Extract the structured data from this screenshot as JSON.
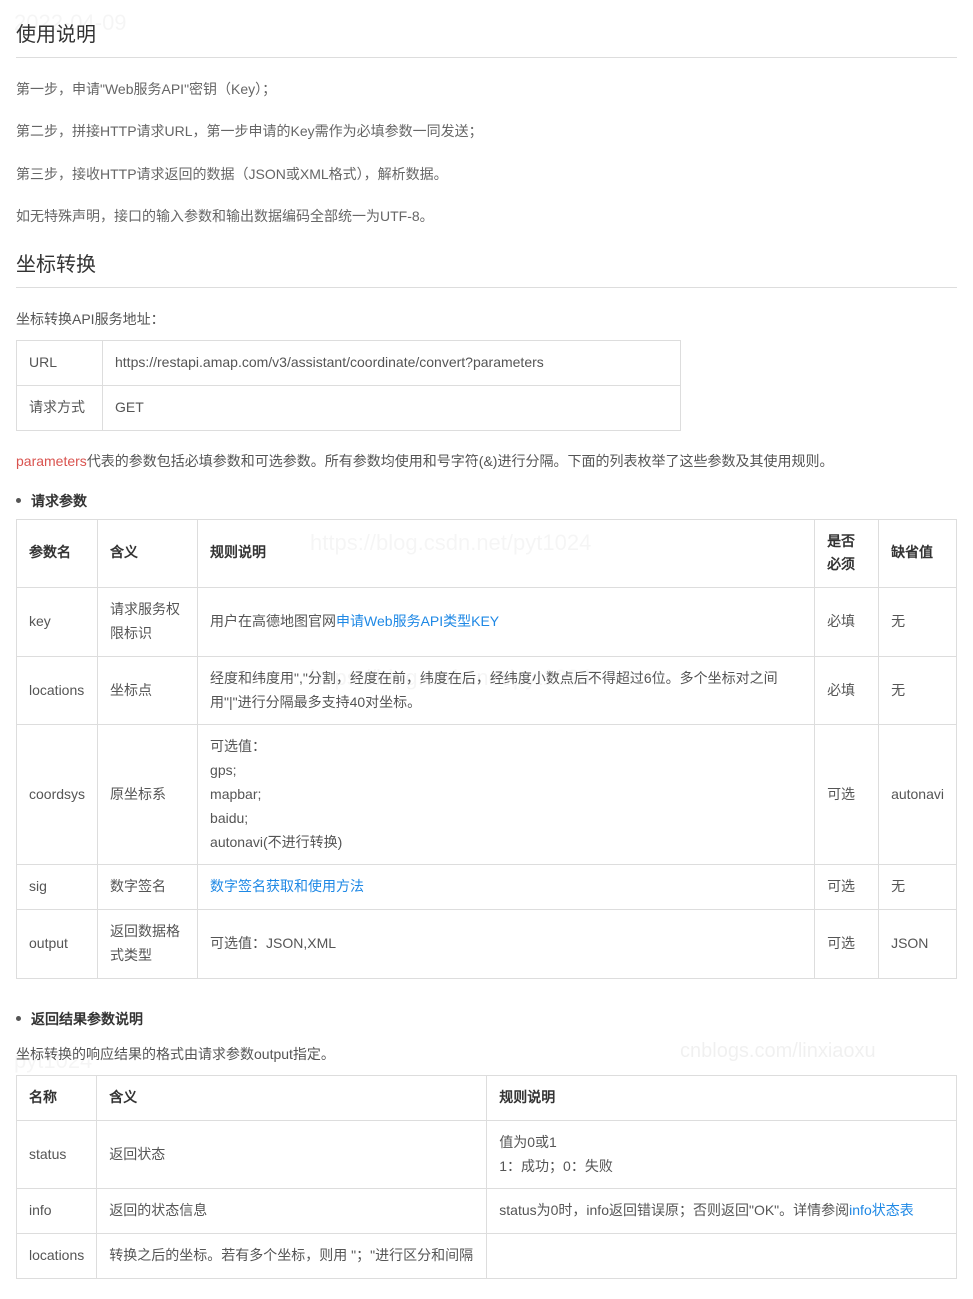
{
  "watermarks": {
    "w1": "2022-04-09",
    "w2": "https://blog.csdn.net/pyt1024",
    "w3": "https://blog.csdn.net/pyt1024",
    "w4": "cnblogs.com/linxiaoxu",
    "w5": "pyt1024"
  },
  "section1": {
    "title": "使用说明",
    "p1": "第一步，申请\"Web服务API\"密钥（Key）；",
    "p2": "第二步，拼接HTTP请求URL，第一步申请的Key需作为必填参数一同发送；",
    "p3": "第三步，接收HTTP请求返回的数据（JSON或XML格式），解析数据。",
    "p4": "如无特殊声明，接口的输入参数和输出数据编码全部统一为UTF-8。"
  },
  "section2": {
    "title": "坐标转换",
    "intro": "坐标转换API服务地址：",
    "url_table": {
      "rows": [
        {
          "label": "URL",
          "value": "https://restapi.amap.com/v3/assistant/coordinate/convert?parameters"
        },
        {
          "label": "请求方式",
          "value": "GET"
        }
      ]
    },
    "params_note_red": "parameters",
    "params_note_rest": "代表的参数包括必填参数和可选参数。所有参数均使用和号字符(&)进行分隔。下面的列表枚举了这些参数及其使用规则。",
    "request_bullet": "请求参数",
    "request_table": {
      "headers": [
        "参数名",
        "含义",
        "规则说明",
        "是否必须",
        "缺省值"
      ],
      "rows": [
        {
          "c0": "key",
          "c1": "请求服务权限标识",
          "c2_pre": "用户在高德地图官网",
          "c2_link": "申请Web服务API类型KEY",
          "c2_post": "",
          "c3": "必填",
          "c4": "无"
        },
        {
          "c0": "locations",
          "c1": "坐标点",
          "c2": "经度和纬度用\",\"分割，经度在前，纬度在后，经纬度小数点后不得超过6位。多个坐标对之间用\"|\"进行分隔最多支持40对坐标。",
          "c3": "必填",
          "c4": "无"
        },
        {
          "c0": "coordsys",
          "c1": "原坐标系",
          "c2_lines": [
            "可选值：",
            "gps;",
            "mapbar;",
            "baidu;",
            "autonavi(不进行转换)"
          ],
          "c3": "可选",
          "c4": "autonavi"
        },
        {
          "c0": "sig",
          "c1": "数字签名",
          "c2_linkonly": "数字签名获取和使用方法",
          "c3": "可选",
          "c4": "无"
        },
        {
          "c0": "output",
          "c1": "返回数据格式类型",
          "c2": "可选值：JSON,XML",
          "c3": "可选",
          "c4": "JSON"
        }
      ]
    },
    "response_bullet": "返回结果参数说明",
    "response_intro": "坐标转换的响应结果的格式由请求参数output指定。",
    "response_table": {
      "headers": [
        "名称",
        "含义",
        "规则说明"
      ],
      "rows": [
        {
          "c0": "status",
          "c1": "返回状态",
          "c2_lines": [
            "值为0或1",
            "1：成功；0：失败"
          ]
        },
        {
          "c0": "info",
          "c1": "返回的状态信息",
          "c2_pre": "status为0时，info返回错误原；否则返回\"OK\"。详情参阅",
          "c2_link": "info状态表"
        },
        {
          "c0": "locations",
          "c1": "转换之后的坐标。若有多个坐标，则用 \"；\"进行区分和间隔",
          "c2": ""
        }
      ]
    }
  }
}
